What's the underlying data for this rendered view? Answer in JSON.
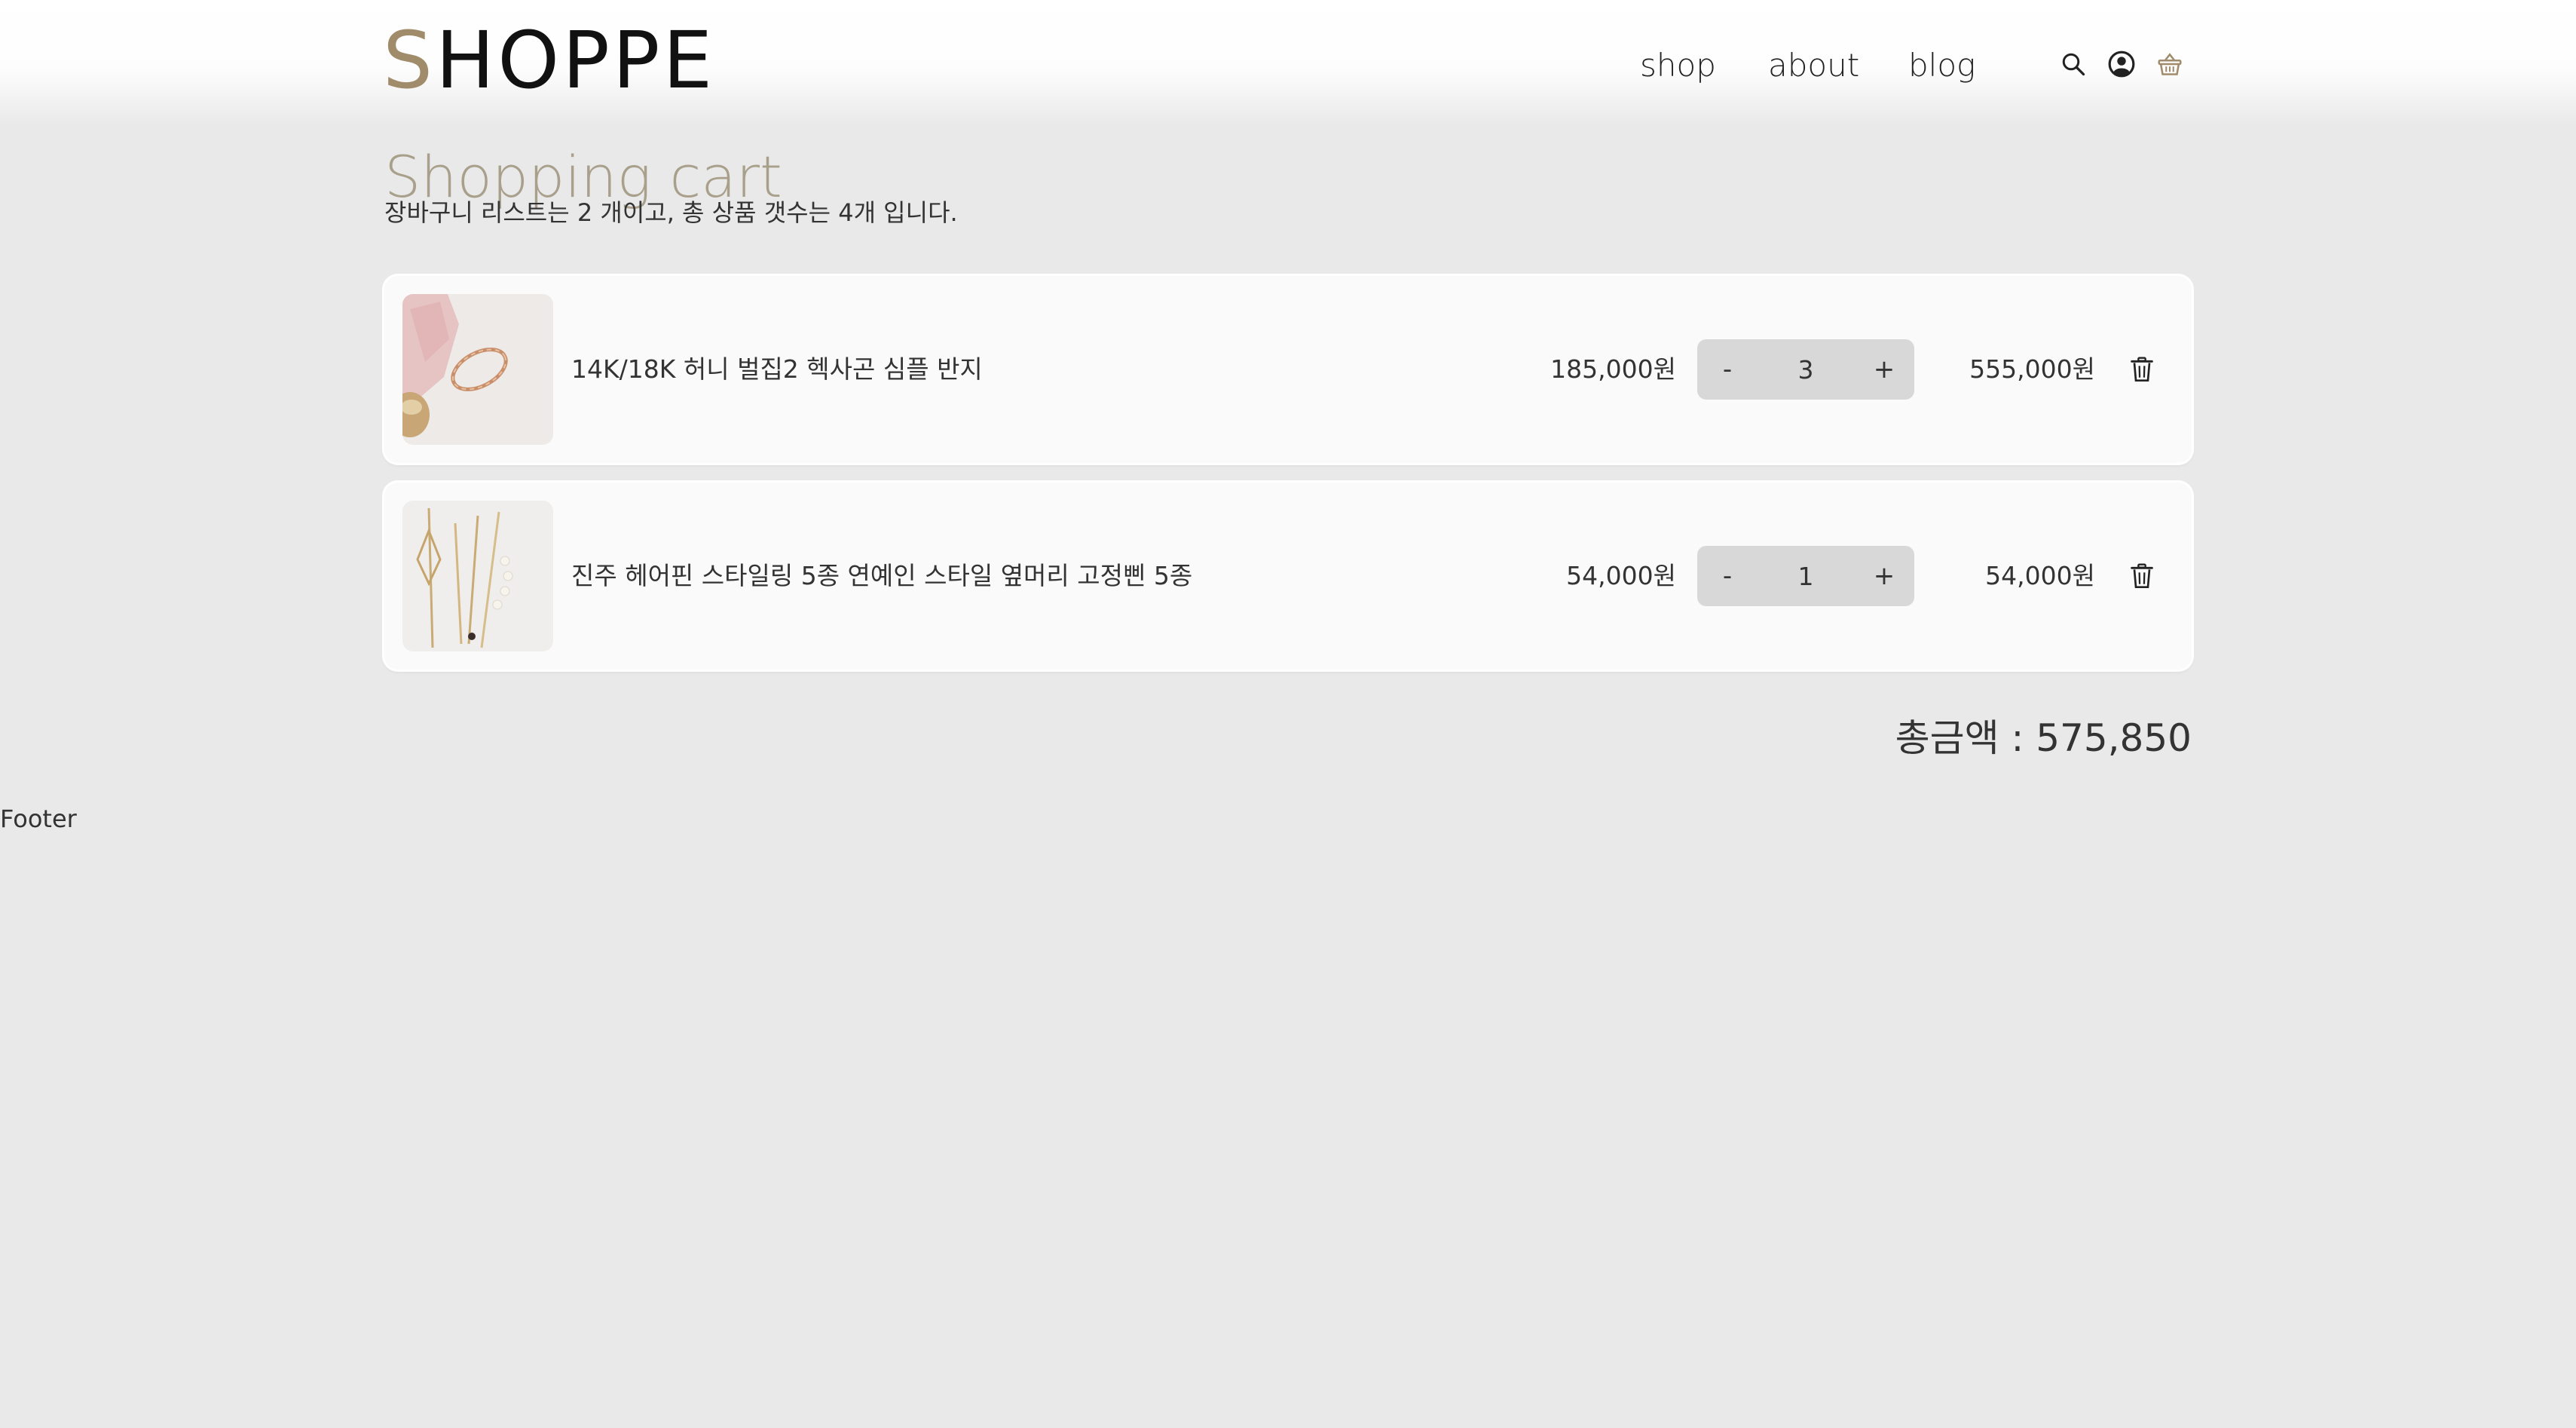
{
  "header": {
    "logo_first": "S",
    "logo_rest": "HOPPE",
    "nav": [
      "shop",
      "about",
      "blog"
    ],
    "icons": [
      "search-icon",
      "user-icon",
      "basket-icon"
    ]
  },
  "cart": {
    "title": "Shopping cart",
    "summary": "장바구니 리스트는 2 개이고, 총 상품 갯수는 4개 입니다.",
    "items": [
      {
        "name": "14K/18K 허니 벌집2 헥사곤 심플 반지",
        "unit_price": "185,000원",
        "minus": "-",
        "quantity": "3",
        "plus": "+",
        "line_total": "555,000원"
      },
      {
        "name": "진주 헤어핀 스타일링 5종 연예인 스타일 옆머리 고정삔 5종",
        "unit_price": "54,000원",
        "minus": "-",
        "quantity": "1",
        "plus": "+",
        "line_total": "54,000원"
      }
    ],
    "total": "총금액 : 575,850"
  },
  "footer": {
    "text": "Footer"
  },
  "colors": {
    "accent": "#a08c6b",
    "title": "#a9a08c",
    "background": "#e9e9e9",
    "card": "#fafafa",
    "qty_bg": "#d8d8d8"
  }
}
